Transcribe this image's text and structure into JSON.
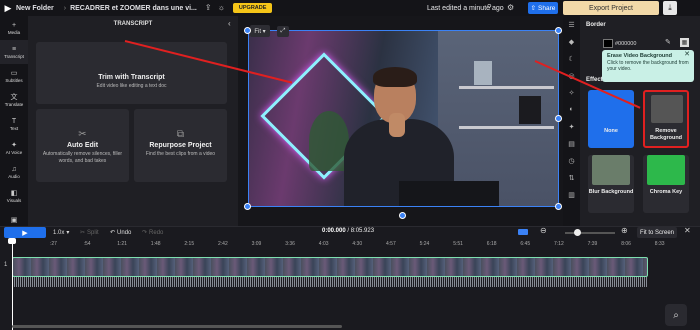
{
  "topbar": {
    "logo_icon": "veed-logo",
    "folder": "New Folder",
    "separator": "›",
    "project_title": "RECADRER et ZOOMER dans une vi...",
    "upgrade_label": "UPGRADE",
    "edited_text": "Last edited a minute ago",
    "share_label": "Share",
    "export_label": "Export Project"
  },
  "left_nav": [
    {
      "label": "Media",
      "icon": "+"
    },
    {
      "label": "Transcript",
      "icon": "≡"
    },
    {
      "label": "Subtitles",
      "icon": "▭"
    },
    {
      "label": "Translate",
      "icon": "文"
    },
    {
      "label": "Text",
      "icon": "T"
    },
    {
      "label": "AI Voice",
      "icon": "✦"
    },
    {
      "label": "Audio",
      "icon": "♫"
    },
    {
      "label": "Visuals",
      "icon": "◧"
    },
    {
      "label": "",
      "icon": "▣"
    }
  ],
  "transcript_panel": {
    "title": "TRANSCRIPT",
    "trim": {
      "title": "Trim with Transcript",
      "desc": "Edit video like editing a text doc"
    },
    "auto_edit": {
      "title": "Auto Edit",
      "desc": "Automatically remove silences, filler words, and bad takes"
    },
    "repurpose": {
      "title": "Repurpose Project",
      "desc": "Find the best clips from a video"
    }
  },
  "canvas": {
    "fit_label": "Fit ▾"
  },
  "right_panel": {
    "border_label": "Border",
    "border_color": "#000000",
    "effects_label": "Effects",
    "tooltip_title": "Erase Video Background",
    "tooltip_desc": "Click to remove the background from your video.",
    "tiles": [
      {
        "label": "None"
      },
      {
        "label": "Remove Background"
      },
      {
        "label": "Blur Background"
      },
      {
        "label": "Chroma Key"
      }
    ]
  },
  "timeline": {
    "speed": "1.0x",
    "split_label": "Split",
    "undo_label": "Undo",
    "redo_label": "Redo",
    "current_time": "0:00.000",
    "total_time": "/ 8:05.923",
    "fit_to_screen": "Fit to Screen",
    "track_number": "1",
    "ticks": [
      ":27",
      ":54",
      "1:21",
      "1:48",
      "2:15",
      "2:42",
      "3:09",
      "3:36",
      "4:03",
      "4:30",
      "4:57",
      "5:24",
      "5:51",
      "6:18",
      "6:45",
      "7:12",
      "7:39",
      "8:06",
      "8:33"
    ]
  },
  "colors": {
    "accent": "#1f6feb",
    "upgrade": "#f5c518",
    "export_bg": "#f2d9a8",
    "tooltip_bg": "#c9f0e6",
    "highlight_box": "#e02020"
  }
}
